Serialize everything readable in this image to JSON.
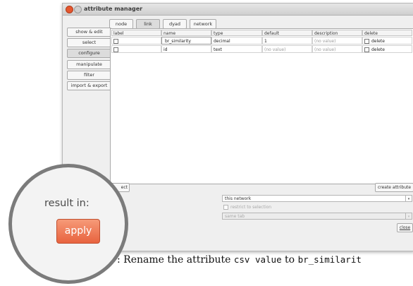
{
  "window": {
    "title": "attribute manager"
  },
  "tabs": [
    "node",
    "link",
    "dyad",
    "network"
  ],
  "sidebar": [
    "show & edit",
    "select",
    "configure",
    "manipulate",
    "filter",
    "import & export"
  ],
  "table": {
    "headers": [
      "label",
      "name",
      "type",
      "default",
      "description",
      "delete"
    ],
    "rows": [
      {
        "name": "br_similarity",
        "type": "decimal",
        "default": "1",
        "description": "(no value)",
        "delete": "delete"
      },
      {
        "name": "id",
        "type": "text",
        "default": "(no value)",
        "description": "(no value)",
        "delete": "delete"
      }
    ]
  },
  "bottom": {
    "partial_button": "ect",
    "create_button": "create attribute",
    "target": "this network",
    "restrict": "restrict to selection",
    "output": "same tab",
    "close": "close"
  },
  "magnifier": {
    "label": "result in:",
    "apply": "apply"
  },
  "caption": {
    "prefix": ": Rename the attribute",
    "old": "csv value",
    "mid": "to",
    "new": "br_similarit"
  },
  "colors": {
    "apply_button": "#e8633f",
    "close_dot": "#e5572f"
  }
}
